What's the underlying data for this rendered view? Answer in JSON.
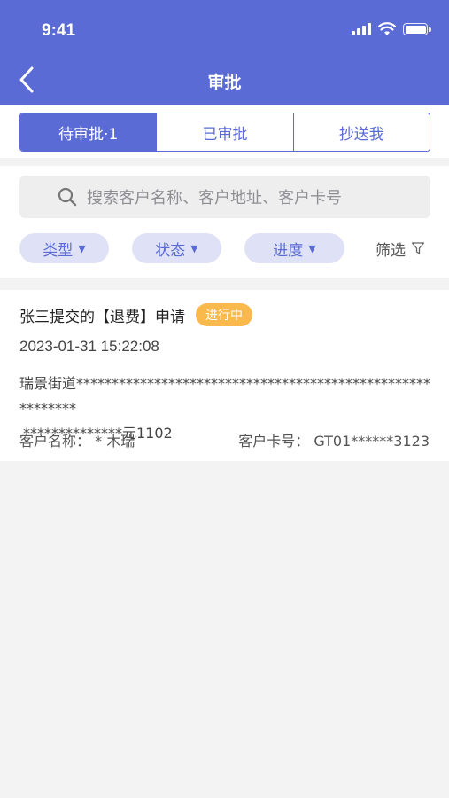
{
  "status_bar": {
    "time": "9:41"
  },
  "nav": {
    "title": "审批"
  },
  "tabs": [
    {
      "label": "待审批·1",
      "active": true
    },
    {
      "label": "已审批",
      "active": false
    },
    {
      "label": "抄送我",
      "active": false
    }
  ],
  "search": {
    "placeholder": "搜索客户名称、客户地址、客户卡号"
  },
  "filters": {
    "chips": [
      {
        "label": "类型"
      },
      {
        "label": "状态"
      },
      {
        "label": "进度"
      }
    ],
    "caret": "▼",
    "filter_label": "筛选"
  },
  "card": {
    "title": "张三提交的【退费】申请",
    "badge": "进行中",
    "time": "2023-01-31 15:22:08",
    "address_line1": "瑞景街道**********************************************************",
    "address_line2": "**************元1102",
    "customer_name_label": "客户名称：",
    "customer_name_value": "* 木瑞",
    "card_no_label": "客户卡号：",
    "card_no_value": "GT01******3123"
  },
  "colors": {
    "primary": "#5a6bd5",
    "badge": "#f9b94c",
    "chip_bg": "#dfe2f7",
    "background": "#f3f3f3"
  }
}
